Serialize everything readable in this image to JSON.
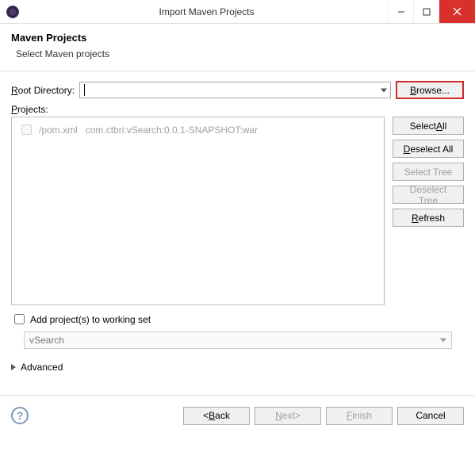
{
  "window": {
    "title": "Import Maven Projects"
  },
  "header": {
    "title": "Maven Projects",
    "subtitle": "Select Maven projects"
  },
  "root_dir": {
    "label_pre": "R",
    "label_rest": "oot Directory:",
    "value": ""
  },
  "browse": {
    "pre": "B",
    "rest": "rowse..."
  },
  "projects_label": {
    "pre": "P",
    "rest": "rojects:"
  },
  "project_item": {
    "path": "/pom.xml",
    "gav": "com.ctbri:vSearch:0.0.1-SNAPSHOT:war"
  },
  "side": {
    "select_all": {
      "pre": "Select ",
      "mn": "A",
      "post": "ll"
    },
    "deselect_all": {
      "pre": "D",
      "rest": "eselect All"
    },
    "select_tree": "Select Tree",
    "deselect_tree": "Deselect Tree",
    "refresh": {
      "pre": "R",
      "rest": "efresh"
    }
  },
  "workingset": {
    "checkbox_label": "Add project(s) to working set",
    "selected": "vSearch"
  },
  "advanced": {
    "label": "Advanced"
  },
  "buttons": {
    "back": {
      "lt": "<",
      "sp": " ",
      "mn": "B",
      "rest": "ack"
    },
    "next": {
      "mn": "N",
      "rest": "ext",
      "gt": ">"
    },
    "finish": {
      "mn": "F",
      "rest": "inish"
    },
    "cancel": "Cancel"
  }
}
